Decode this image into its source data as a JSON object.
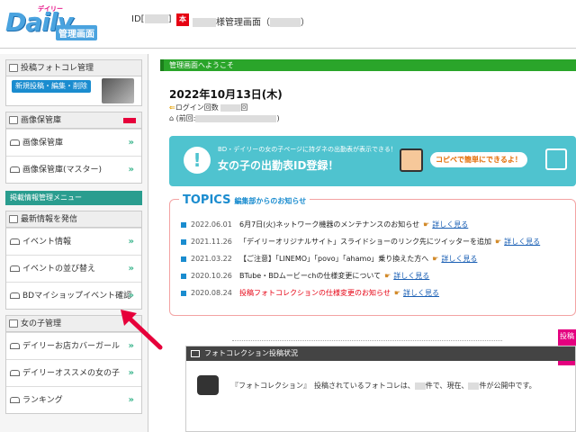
{
  "header": {
    "logo_tagline": "デイリー",
    "logo_main": "Daily",
    "logo_sub": "管理画面",
    "id_label": "ID[",
    "id_close": "]",
    "hon": "本",
    "manager_label": "様管理画面（",
    "manager_close": "）"
  },
  "sidebar": {
    "photo_box": {
      "title": "投稿フォトコレ管理",
      "button": "新規投稿・編集・削除"
    },
    "image_box": {
      "title": "画像保管庫",
      "items": [
        "画像保管庫",
        "画像保管庫(マスター)"
      ]
    },
    "section_label": "掲載情報管理メニュー",
    "latest_box": {
      "title": "最新情報を発信",
      "items": [
        "イベント情報",
        "イベントの並び替え",
        "BDマイショップイベント確認"
      ]
    },
    "girls_box": {
      "title": "女の子管理",
      "items": [
        "デイリーお店カバーガール",
        "デイリーオススメの女の子",
        "ランキング"
      ]
    },
    "arrow_glyph": "»"
  },
  "main": {
    "welcome": "管理画面へようこそ",
    "date": "2022年10月13日(木)",
    "login_label": "ログイン回数",
    "login_suffix": "回",
    "prev_label": "(前回:",
    "prev_close": ")",
    "banner": {
      "small": "BD・デイリーの女の子ページに持ダネの出勤表が表示できる！",
      "big": "女の子の出勤表ID登録！",
      "bubble": "コピペで簡単にできるよ！"
    },
    "topics": {
      "title": "TOPICS",
      "subtitle": "編集部からのお知らせ",
      "more_label": "詳しく見る",
      "items": [
        {
          "date": "2022.06.01",
          "text": "6月7日(火)ネットワーク機器のメンテナンスのお知らせ",
          "red": false
        },
        {
          "date": "2021.11.26",
          "text": "「デイリーオリジナルサイト」スライドショーのリンク先にツイッターを追加",
          "red": false
        },
        {
          "date": "2021.03.22",
          "text": "【ご注意】「LINEMO」「povo」「ahamo」乗り換えた方へ",
          "red": false
        },
        {
          "date": "2020.10.26",
          "text": "BTube・BDムービーchの仕様変更について",
          "red": false
        },
        {
          "date": "2020.08.24",
          "text": "投稿フォトコレクションの仕様変更のお知らせ",
          "red": true
        }
      ]
    },
    "photo_status": {
      "title": "フォトコレクション投稿状況",
      "text_a": "『フォトコレクション』　投稿されているフォトコレは、",
      "text_b": "件で、現在、",
      "text_c": "件が公開中です。"
    },
    "side_tag": "投稿"
  },
  "colors": {
    "accent_blue": "#1a8ccf",
    "welcome_green": "#2aa52a",
    "banner_teal": "#4fc3cf",
    "pointer_red": "#e6003a"
  }
}
